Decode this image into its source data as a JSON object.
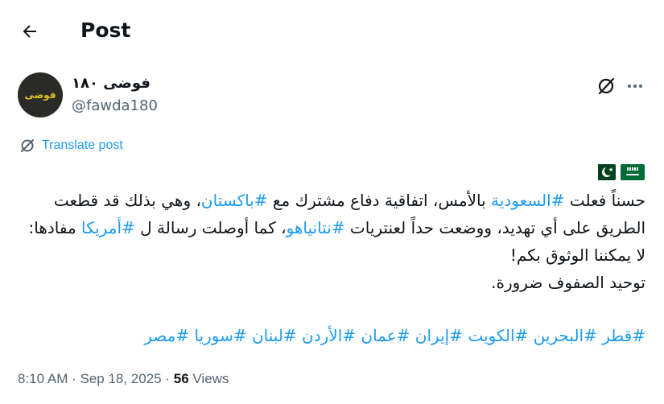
{
  "header": {
    "title": "Post",
    "back_icon": "arrow-left-icon"
  },
  "author": {
    "avatar_text": "فوضى",
    "display_name": "فوضى ١٨٠",
    "handle": "@fawda180",
    "grok_icon": "grok-icon",
    "more_icon": "more-horizontal-icon"
  },
  "translate": {
    "label": "Translate post",
    "icon": "translate-icon"
  },
  "flags": [
    "saudi-arabia-flag",
    "pakistan-flag"
  ],
  "tweet": {
    "line1_a": "حسناً فعلت ",
    "tag_saudi": "#السعودية",
    "line1_b": " بالأمس، اتفاقية دفاع مشترك مع ",
    "tag_pakistan": "#باكستان",
    "line1_c": "، وهي بذلك قد قطعت الطريق على أي تهديد، ووضعت حداً لعنتريات ",
    "tag_netanyahu": "#نتانياهو",
    "line1_d": "، كما أوصلت رسالة ل ",
    "tag_america": "#أمريكا",
    "line1_e": " مفادها: لا يمكننا الوثوق بكم!",
    "line2": "توحيد الصفوف ضرورة."
  },
  "hashtags": [
    "#قطر",
    "#البحرين",
    "#الكويت",
    "#إيران",
    "#عمان",
    "#الأردن",
    "#لبنان",
    "#سوريا",
    "#مصر"
  ],
  "meta": {
    "time": "8:10 AM",
    "separator": " · ",
    "date": "Sep 18, 2025",
    "views_count": "56",
    "views_label": " Views"
  },
  "colors": {
    "link": "#1d9bf0",
    "text": "#0f1419",
    "secondary": "#536471"
  }
}
